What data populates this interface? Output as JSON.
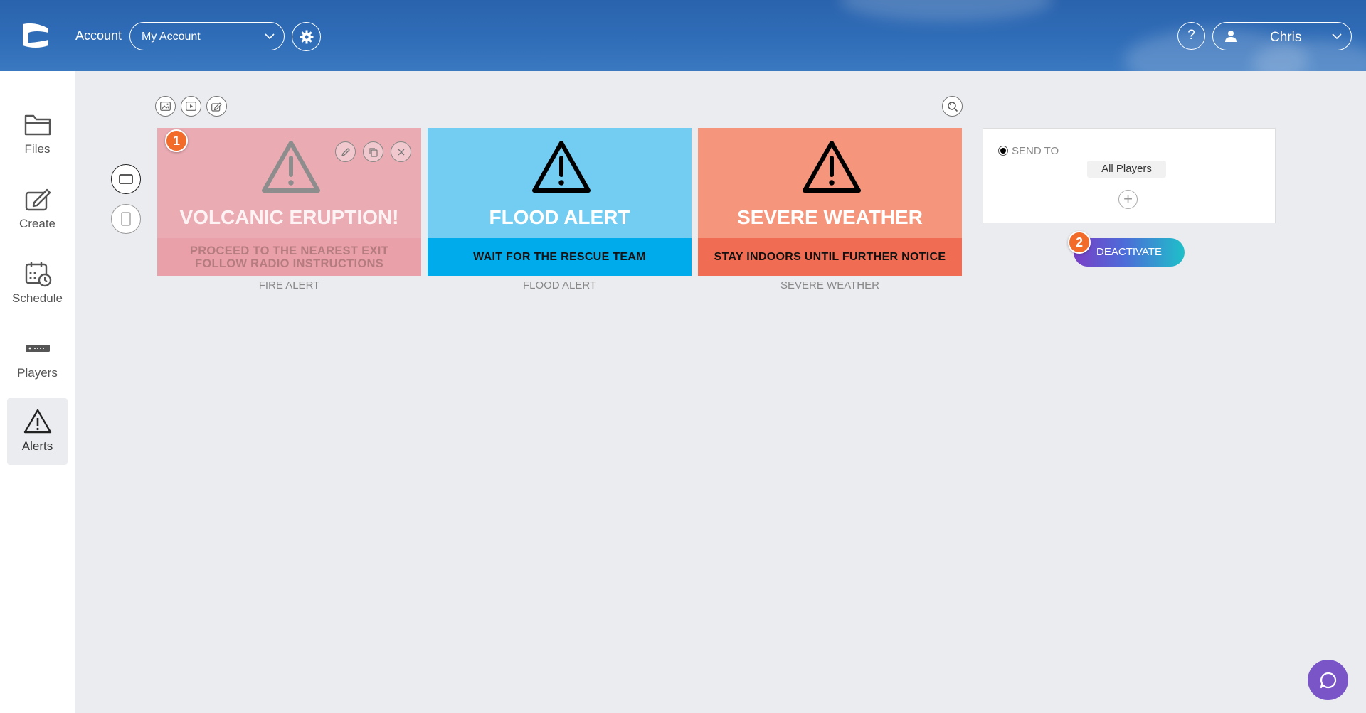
{
  "header": {
    "account_label": "Account",
    "account_select_value": "My Account",
    "help_label": "?",
    "user_name": "Chris"
  },
  "sidebar": {
    "items": [
      {
        "label": "Files",
        "icon": "folder-icon"
      },
      {
        "label": "Create",
        "icon": "edit-icon"
      },
      {
        "label": "Schedule",
        "icon": "calendar-clock-icon"
      },
      {
        "label": "Players",
        "icon": "player-device-icon"
      },
      {
        "label": "Alerts",
        "icon": "warning-icon",
        "active": true
      }
    ]
  },
  "cards": [
    {
      "title": "VOLCANIC ERUPTION!",
      "line1": "PROCEED TO THE NEAREST EXIT",
      "line2": "FOLLOW RADIO INSTRUCTIONS",
      "caption": "FIRE ALERT",
      "top_color": "#eaabb3",
      "band_color": "#e9a0a8"
    },
    {
      "title": "FLOOD ALERT",
      "message": "WAIT FOR THE RESCUE TEAM",
      "caption": "FLOOD ALERT",
      "top_color": "#73cdf2",
      "band_color": "#00abeb"
    },
    {
      "title": "SEVERE WEATHER",
      "message": "STAY INDOORS UNTIL FURTHER NOTICE",
      "caption": "SEVERE WEATHER",
      "top_color": "#f5957b",
      "band_color": "#f06c52"
    }
  ],
  "badges": {
    "one": "1",
    "two": "2"
  },
  "send_panel": {
    "send_to_label": "SEND TO",
    "recipient": "All Players",
    "add_symbol": "+"
  },
  "actions": {
    "deactivate_label": "DEACTIVATE"
  },
  "colors": {
    "header_blue": "#2f6cb7",
    "badge_orange": "#f26b28",
    "chat_purple": "#7a55c8"
  }
}
